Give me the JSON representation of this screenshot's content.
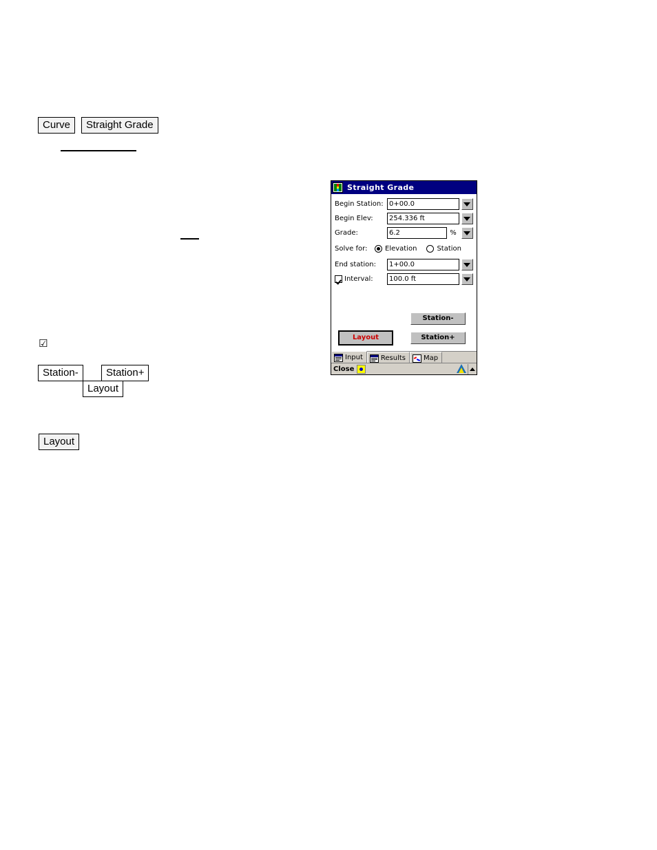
{
  "document": {
    "inline_boxes": [
      {
        "id": "curve",
        "label": "Curve"
      },
      {
        "id": "straight-grade",
        "label": "Straight Grade"
      },
      {
        "id": "station-minus",
        "label": "Station-"
      },
      {
        "id": "station-plus",
        "label": "Station+"
      },
      {
        "id": "layout-ref",
        "label": "Layout"
      },
      {
        "id": "layout-ref2",
        "label": "Layout"
      }
    ],
    "checkbox_glyph": "☑"
  },
  "dialog": {
    "title": "Straight Grade",
    "title_icon": "survey-program-icon",
    "fields": [
      {
        "label": "Begin Station:",
        "value": "0+00.0",
        "unit": ""
      },
      {
        "label": "Begin Elev:",
        "value": "254.336 ft",
        "unit": ""
      },
      {
        "label": "Grade:",
        "value": "6.2",
        "unit": "%"
      }
    ],
    "solve_for": {
      "label": "Solve for:",
      "options": [
        {
          "label": "Elevation",
          "selected": true
        },
        {
          "label": "Station",
          "selected": false
        }
      ]
    },
    "end_station": {
      "label": "End station:",
      "value": "1+00.0"
    },
    "interval": {
      "label": "Interval:",
      "value": "100.0 ft",
      "checked": true
    },
    "buttons": {
      "station_minus": "Station-",
      "station_plus": "Station+",
      "layout": "Layout",
      "layout_color": "#cc0000"
    },
    "tabs": [
      {
        "label": "Input",
        "icon": "input-form-icon",
        "active": true
      },
      {
        "label": "Results",
        "icon": "results-list-icon",
        "active": false
      },
      {
        "label": "Map",
        "icon": "map-icon",
        "active": false
      }
    ],
    "statusbar": {
      "close_label": "Close",
      "close_icon": "close-star-icon",
      "instrument_icon": "tripod-icon",
      "scroll_icon": "scroll-up-icon"
    },
    "colors": {
      "titlebar": "#000080",
      "face": "#d4d0c8",
      "button_face": "#c0c0c0",
      "accent_red": "#cc0000"
    }
  }
}
